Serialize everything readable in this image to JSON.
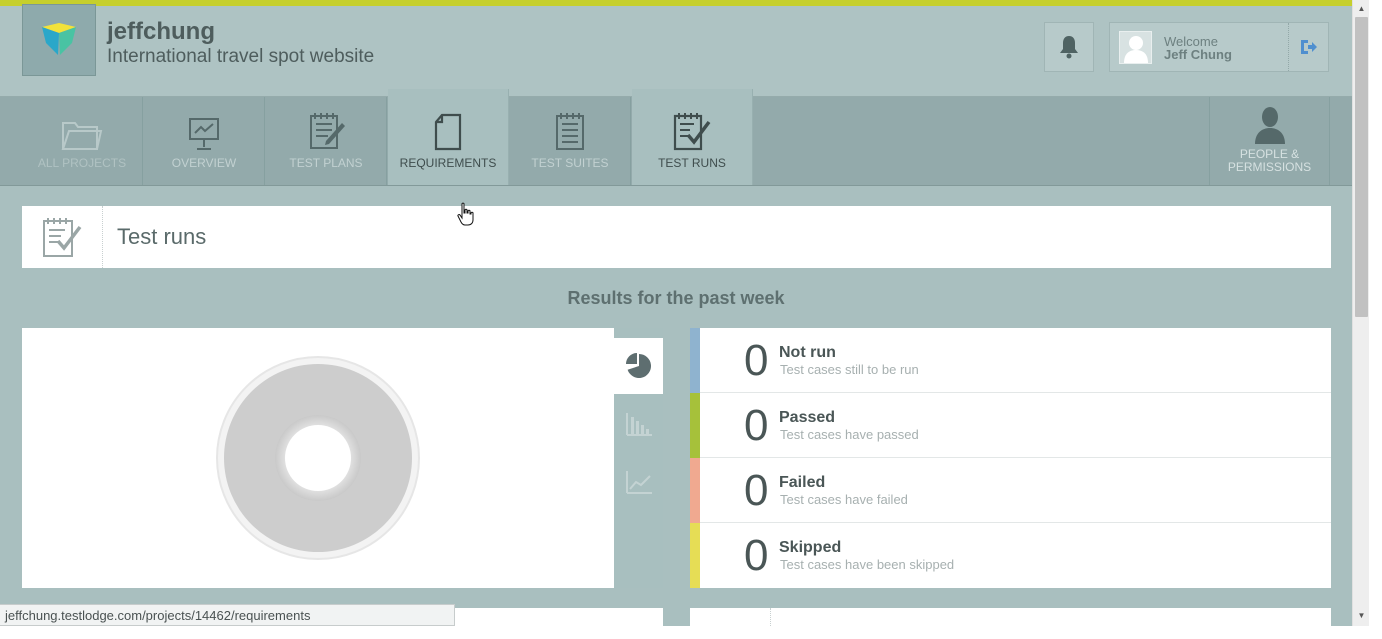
{
  "header": {
    "project_name": "jeffchung",
    "project_desc": "International travel spot website",
    "welcome": "Welcome",
    "user_name": "Jeff Chung"
  },
  "nav": {
    "items": [
      {
        "label": "ALL PROJECTS",
        "icon": "folder-icon"
      },
      {
        "label": "OVERVIEW",
        "icon": "presentation-board-icon"
      },
      {
        "label": "TEST PLANS",
        "icon": "notepad-pencil-icon"
      },
      {
        "label": "REQUIREMENTS",
        "icon": "document-icon"
      },
      {
        "label": "TEST SUITES",
        "icon": "notepad-icon"
      },
      {
        "label": "TEST RUNS",
        "icon": "notepad-check-icon"
      }
    ],
    "people_label_1": "PEOPLE &",
    "people_label_2": "PERMISSIONS"
  },
  "page": {
    "title": "Test runs",
    "results_heading": "Results for the past week"
  },
  "stats": [
    {
      "count": "0",
      "title": "Not run",
      "subtitle": "Test cases still to be run",
      "color": "#8fb3cf"
    },
    {
      "count": "0",
      "title": "Passed",
      "subtitle": "Test cases have passed",
      "color": "#a6c13a"
    },
    {
      "count": "0",
      "title": "Failed",
      "subtitle": "Test cases have failed",
      "color": "#f0a990"
    },
    {
      "count": "0",
      "title": "Skipped",
      "subtitle": "Test cases have been skipped",
      "color": "#e6dd55"
    }
  ],
  "chart_tabs": [
    "pie-chart-icon",
    "bar-chart-icon",
    "line-chart-icon"
  ],
  "status_bar": {
    "url": "jeffchung.testlodge.com/projects/14462/requirements"
  },
  "colors": {
    "accent": "#c6cf2c",
    "background": "#a9bfbf",
    "nav_bg": "#93aaab"
  }
}
